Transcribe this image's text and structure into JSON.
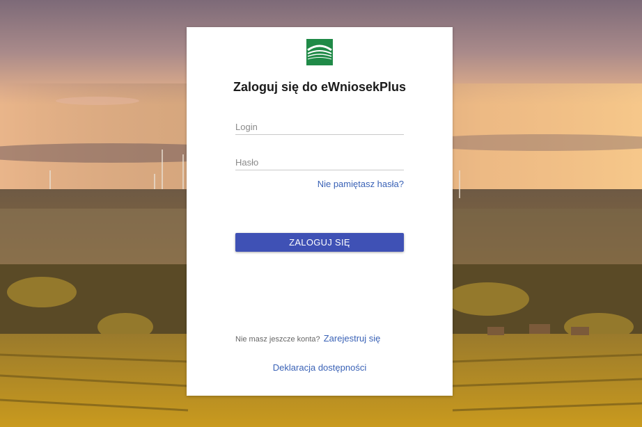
{
  "login": {
    "logo_text": "ARiMR",
    "title": "Zaloguj się do eWniosekPlus",
    "login_placeholder": "Login",
    "password_placeholder": "Hasło",
    "forgot_password": "Nie pamiętasz hasła?",
    "submit_label": "ZALOGUJ SIĘ",
    "no_account_text": "Nie masz jeszcze konta?",
    "register_link": "Zarejestruj się",
    "accessibility_link": "Deklaracja dostępności"
  },
  "colors": {
    "brand_green": "#1f8a47",
    "button": "#3f51b5",
    "link": "#3a62b6"
  },
  "background": {
    "description_icon": "landscape-sunset-vineyard-image"
  }
}
